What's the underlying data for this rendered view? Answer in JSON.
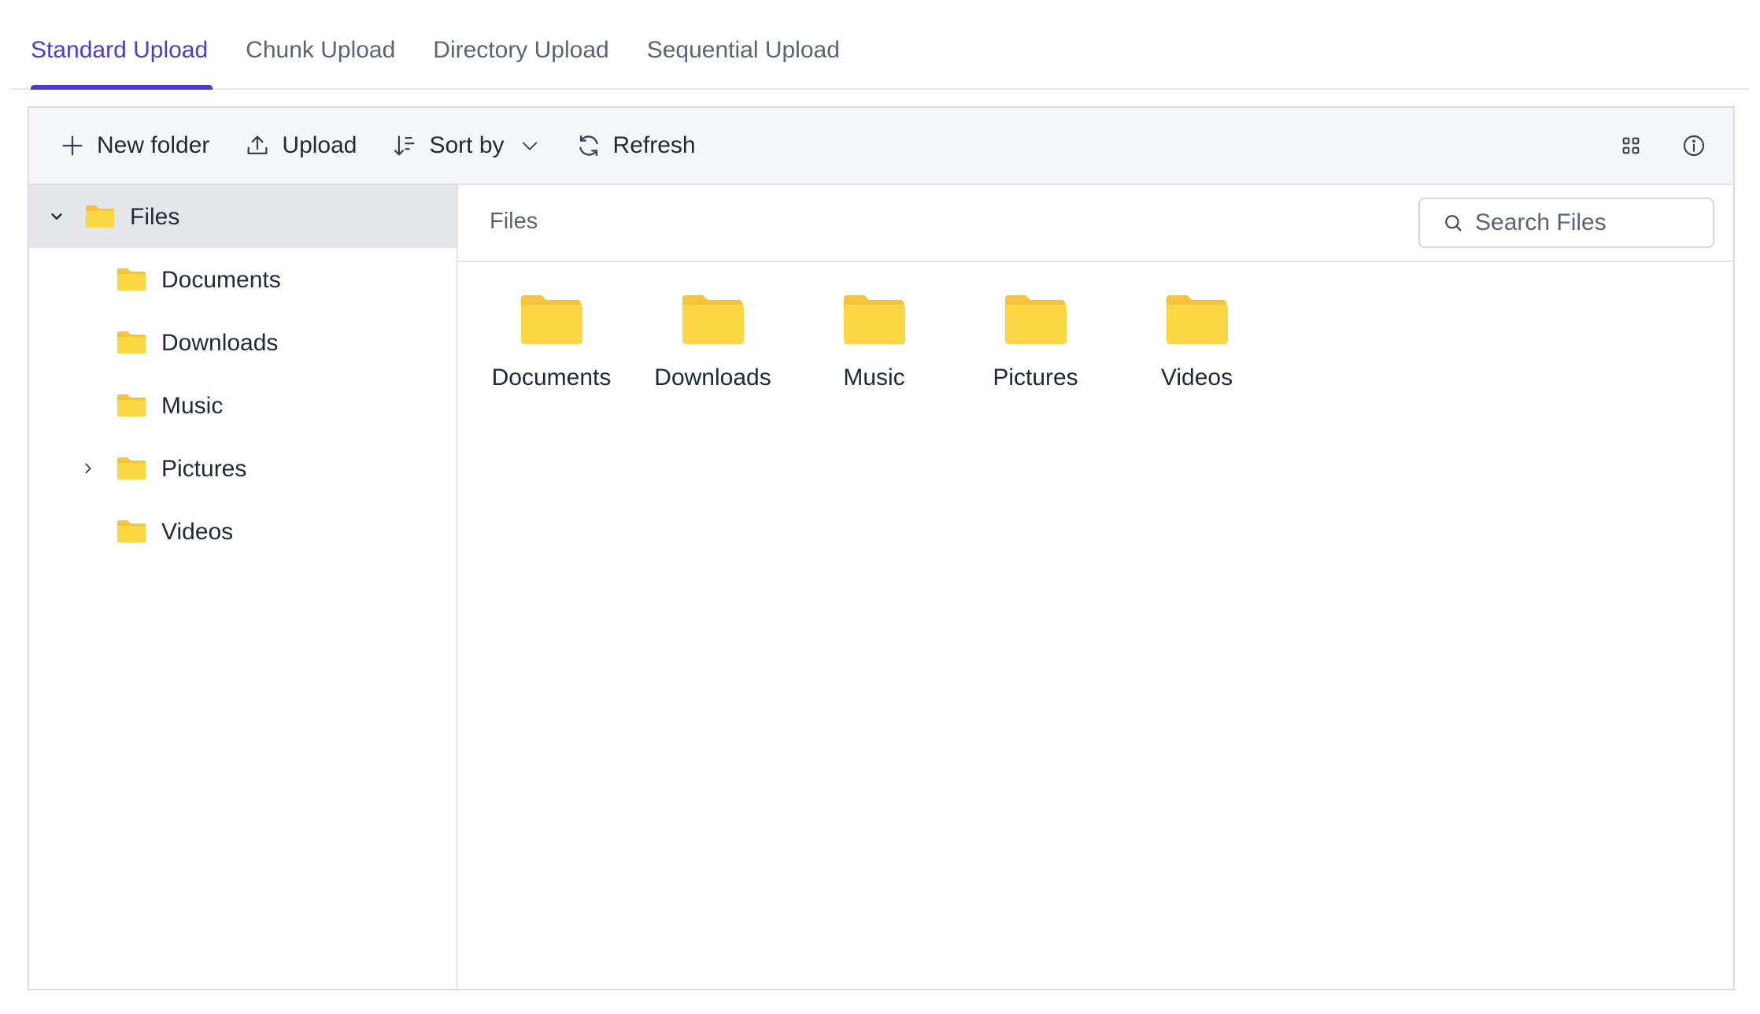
{
  "tabs": [
    {
      "label": "Standard Upload",
      "active": true
    },
    {
      "label": "Chunk Upload",
      "active": false
    },
    {
      "label": "Directory Upload",
      "active": false
    },
    {
      "label": "Sequential Upload",
      "active": false
    }
  ],
  "toolbar": {
    "new_folder": "New folder",
    "upload": "Upload",
    "sort_by": "Sort by",
    "refresh": "Refresh"
  },
  "tree": {
    "root": "Files",
    "children": [
      "Documents",
      "Downloads",
      "Music",
      "Pictures",
      "Videos"
    ]
  },
  "breadcrumb": "Files",
  "search": {
    "placeholder": "Search Files",
    "value": ""
  },
  "items": [
    "Documents",
    "Downloads",
    "Music",
    "Pictures",
    "Videos"
  ],
  "colors": {
    "accent": "#4f3bd1",
    "folder": "#fbd745",
    "folder_back": "#f5c33b",
    "toolbar_bg": "#f5f6f8",
    "selected_bg": "#e5e6e9"
  }
}
